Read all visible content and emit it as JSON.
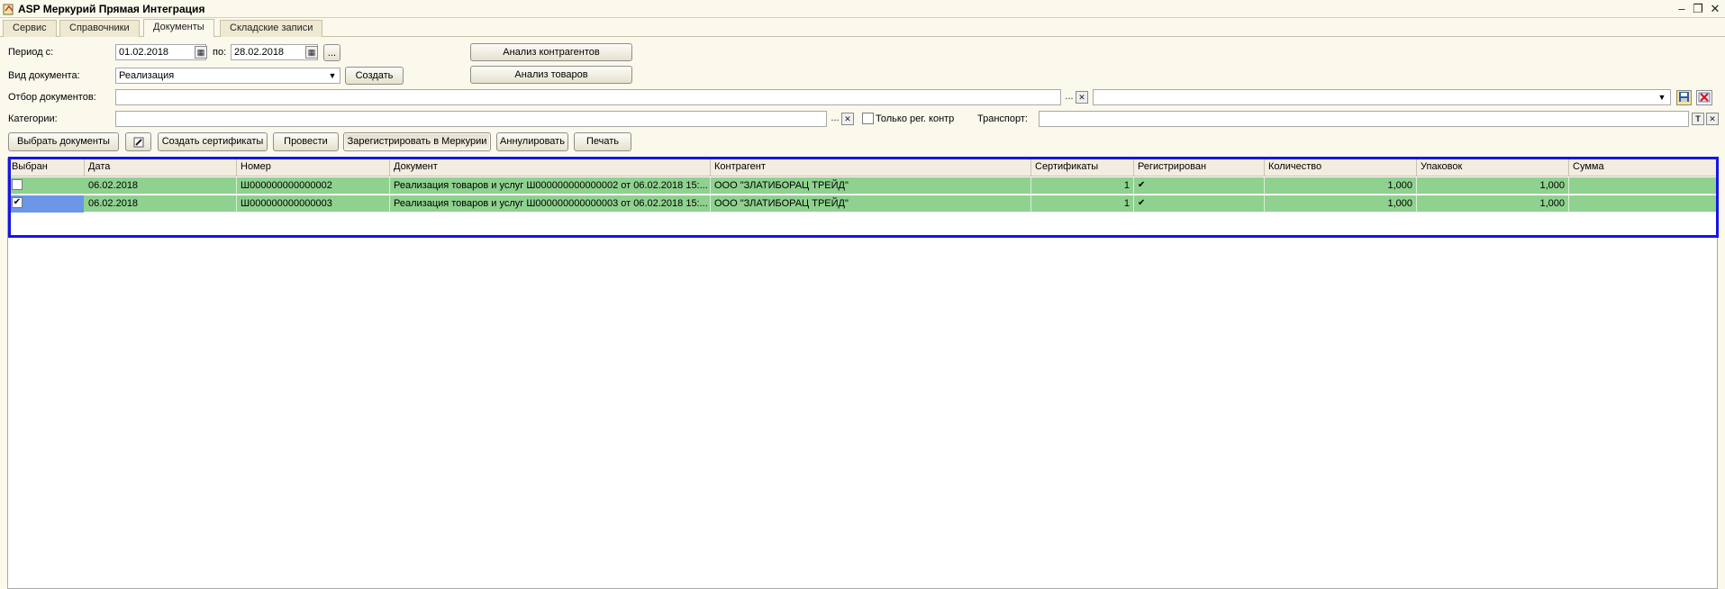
{
  "window": {
    "title": "ASP Меркурий Прямая Интеграция"
  },
  "tabs": [
    "Сервис",
    "Справочники",
    "Документы",
    "Складские записи"
  ],
  "filters": {
    "period_label": "Период с:",
    "date_from": "01.02.2018",
    "to_label": "по:",
    "date_to": "28.02.2018",
    "ellipsis": "...",
    "doc_type_label": "Вид документа:",
    "doc_type_value": "Реализация",
    "create_button": "Создать",
    "analysis_contractors": "Анализ контрагентов",
    "analysis_goods": "Анализ товаров",
    "doc_filter_label": "Отбор документов:",
    "categories_label": "Категории:",
    "only_reg_label": "Только рег. контр",
    "transport_label": "Транспорт:",
    "clear_glyph": "✕",
    "t_glyph": "T"
  },
  "toolbar": {
    "select_docs": "Выбрать документы",
    "create_certs": "Создать сертификаты",
    "post": "Провести",
    "register_mercury": "Зарегистрировать в Меркурии",
    "cancel": "Аннулировать",
    "print": "Печать"
  },
  "table": {
    "columns": [
      "Выбран",
      "Дата",
      "Номер",
      "Документ",
      "Контрагент",
      "Сертификаты",
      "Регистрирован",
      "Количество",
      "Упаковок",
      "Сумма"
    ],
    "rows": [
      {
        "selected": false,
        "date": "06.02.2018",
        "number": "Ш000000000000002",
        "document": "Реализация товаров и услуг Ш000000000000002 от 06.02.2018 15:...",
        "contractor": "ООО \"ЗЛАТИБОРАЦ ТРЕЙД\"",
        "certificates": "1",
        "registered": "✔",
        "quantity": "1,000",
        "packages": "1,000",
        "sum": ""
      },
      {
        "selected": true,
        "date": "06.02.2018",
        "number": "Ш000000000000003",
        "document": "Реализация товаров и услуг Ш000000000000003 от 06.02.2018 15:...",
        "contractor": "ООО \"ЗЛАТИБОРАЦ ТРЕЙД\"",
        "certificates": "1",
        "registered": "✔",
        "quantity": "1,000",
        "packages": "1,000",
        "sum": ""
      }
    ]
  },
  "colors": {
    "row_green": "#8fd18f",
    "highlight_blue": "#1515e8",
    "selected_cell": "#6a97e8"
  }
}
